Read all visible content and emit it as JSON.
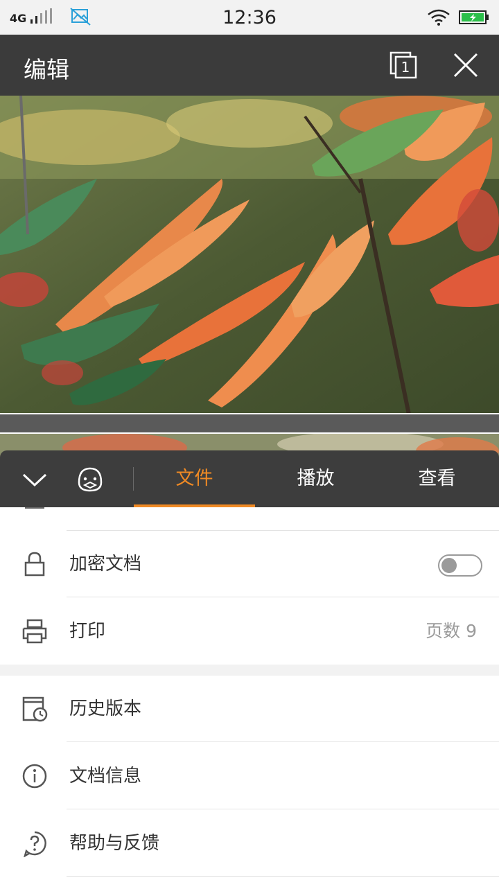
{
  "status_bar": {
    "network": "4G",
    "time": "12:36",
    "icons": [
      "signal-icon",
      "gallery-icon",
      "wifi-icon",
      "battery-icon"
    ],
    "battery_color": "#2bbf4a"
  },
  "title_bar": {
    "title": "编辑",
    "page_count_badge": "1",
    "icons": [
      "pages-icon",
      "close-icon"
    ]
  },
  "tabs": {
    "items": [
      {
        "label": "文件",
        "active": true
      },
      {
        "label": "播放",
        "active": false
      },
      {
        "label": "查看",
        "active": false
      }
    ],
    "active_color": "#f08a24",
    "icons": [
      "collapse-chevron-icon",
      "mascot-icon"
    ]
  },
  "menu": {
    "encrypt": {
      "label": "加密文档",
      "toggle_on": false
    },
    "print": {
      "label": "打印",
      "value": "页数 9"
    },
    "history": {
      "label": "历史版本"
    },
    "doc_info": {
      "label": "文档信息"
    },
    "help": {
      "label": "帮助与反馈"
    }
  }
}
